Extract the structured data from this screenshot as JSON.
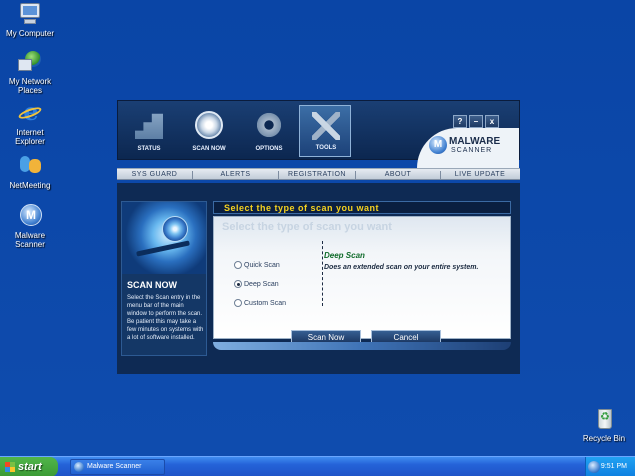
{
  "desktop": {
    "icons": [
      {
        "label": "My Computer"
      },
      {
        "label": "My Network Places"
      },
      {
        "label": "Internet Explorer"
      },
      {
        "label": "NetMeeting"
      },
      {
        "label": "Malware Scanner"
      },
      {
        "label": "Recycle Bin"
      }
    ]
  },
  "app": {
    "nav": [
      {
        "label": "STATUS",
        "icon": "status-icon"
      },
      {
        "label": "SCAN NOW",
        "icon": "scan-icon"
      },
      {
        "label": "OPTIONS",
        "icon": "gears-icon"
      },
      {
        "label": "TOOLS",
        "icon": "tools-icon"
      }
    ],
    "window_buttons": [
      "?",
      "–",
      "x"
    ],
    "logo": {
      "line1": "MALWARE",
      "line2": "SCANNER",
      "mark": "M"
    },
    "menu": [
      "SYS GUARD",
      "ALERTS",
      "REGISTRATION",
      "ABOUT",
      "LIVE UPDATE"
    ],
    "left_panel": {
      "title": "SCAN NOW",
      "description": "Select the Scan entry in the menu bar of the main window to perform the scan. Be patient this may take a few minutes on systems with a lot of software installed."
    },
    "main": {
      "headline": "Select the type of scan you want",
      "ghost_title": "Select the type of scan you want",
      "options": [
        {
          "label": "Quick Scan",
          "selected": false
        },
        {
          "label": "Deep Scan",
          "selected": true
        },
        {
          "label": "Custom Scan",
          "selected": false
        }
      ],
      "detail_title": "Deep Scan",
      "detail_desc": "Does an extended scan on your entire system.",
      "scan_button": "Scan Now",
      "cancel_button": "Cancel"
    },
    "colors": {
      "accent_yellow": "#f5d21f",
      "navy": "#0e2a54",
      "green_text": "#0f6b2a"
    }
  },
  "taskbar": {
    "start": "start",
    "task_label": "Malware Scanner",
    "clock": "9:51 PM"
  }
}
